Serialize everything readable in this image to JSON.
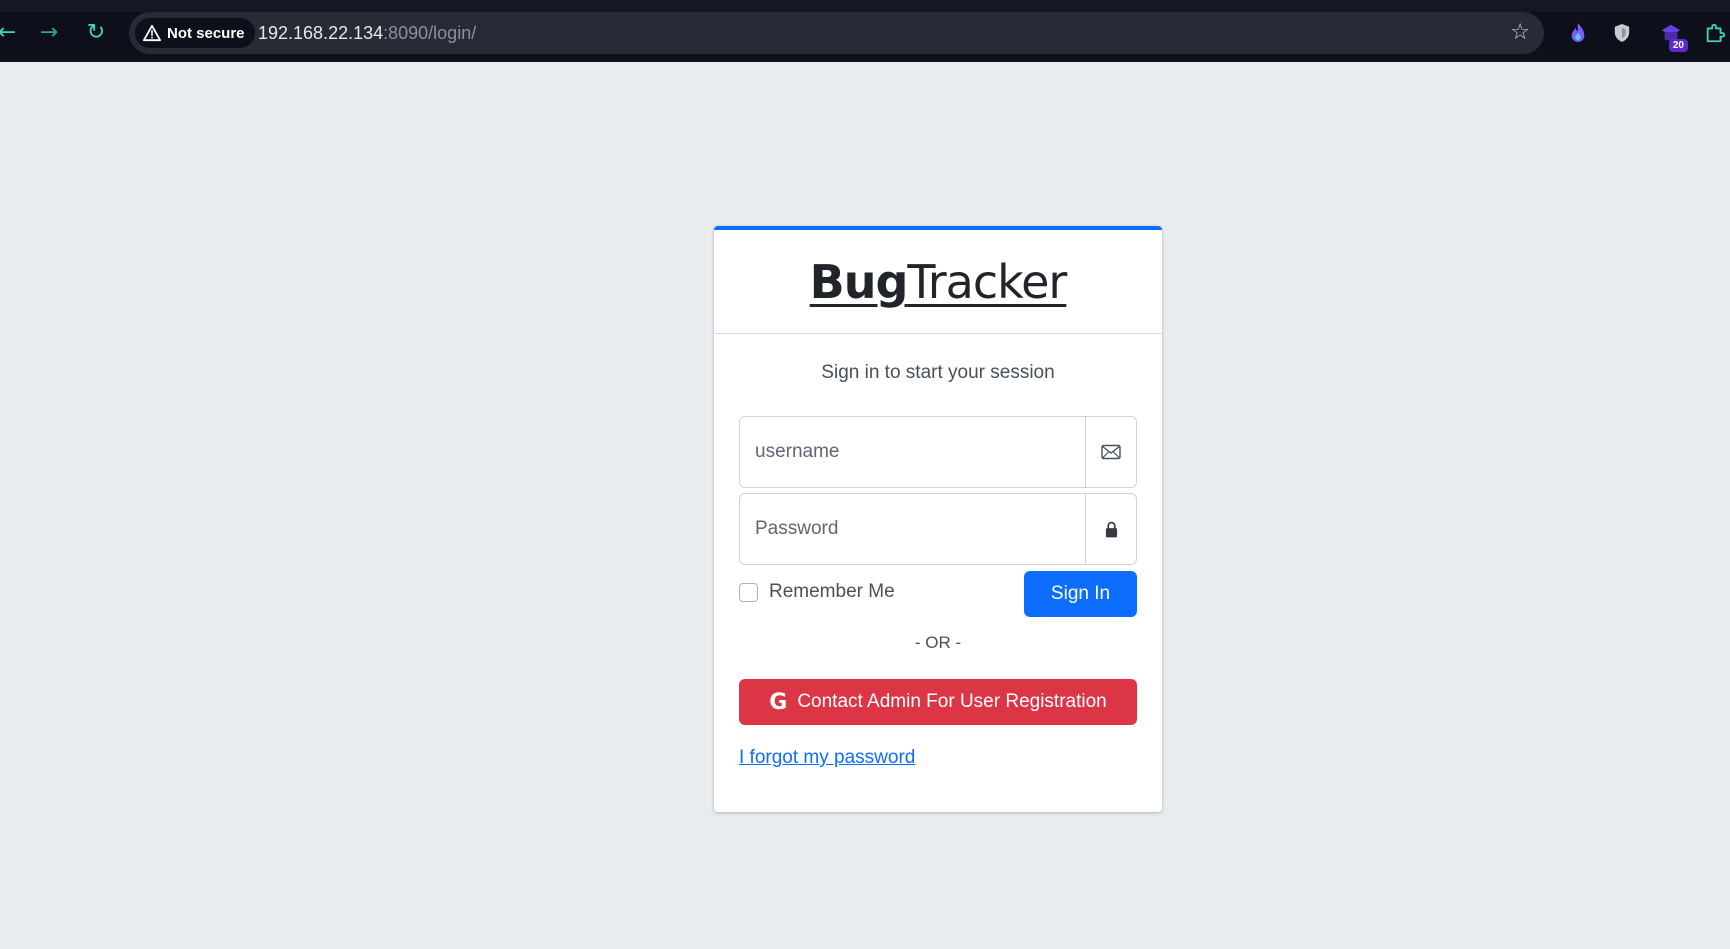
{
  "browser": {
    "security_label": "Not secure",
    "url_host": "192.168.22.134",
    "url_rest": ":8090/login/",
    "extension_badge": "20",
    "accent": "#3fd6b8"
  },
  "login": {
    "brand_bold": "Bug",
    "brand_regular": "Tracker",
    "subtitle": "Sign in to start your session",
    "username_placeholder": "username",
    "password_placeholder": "Password",
    "remember_label": "Remember Me",
    "signin_label": "Sign In",
    "or_text": "- OR -",
    "google_icon_glyph": "G",
    "google_label": "Contact Admin For User Registration",
    "forgot_label": "I forgot my password",
    "colors": {
      "primary": "#0d6efd",
      "danger": "#dc3545",
      "background": "#e9ecef"
    }
  }
}
